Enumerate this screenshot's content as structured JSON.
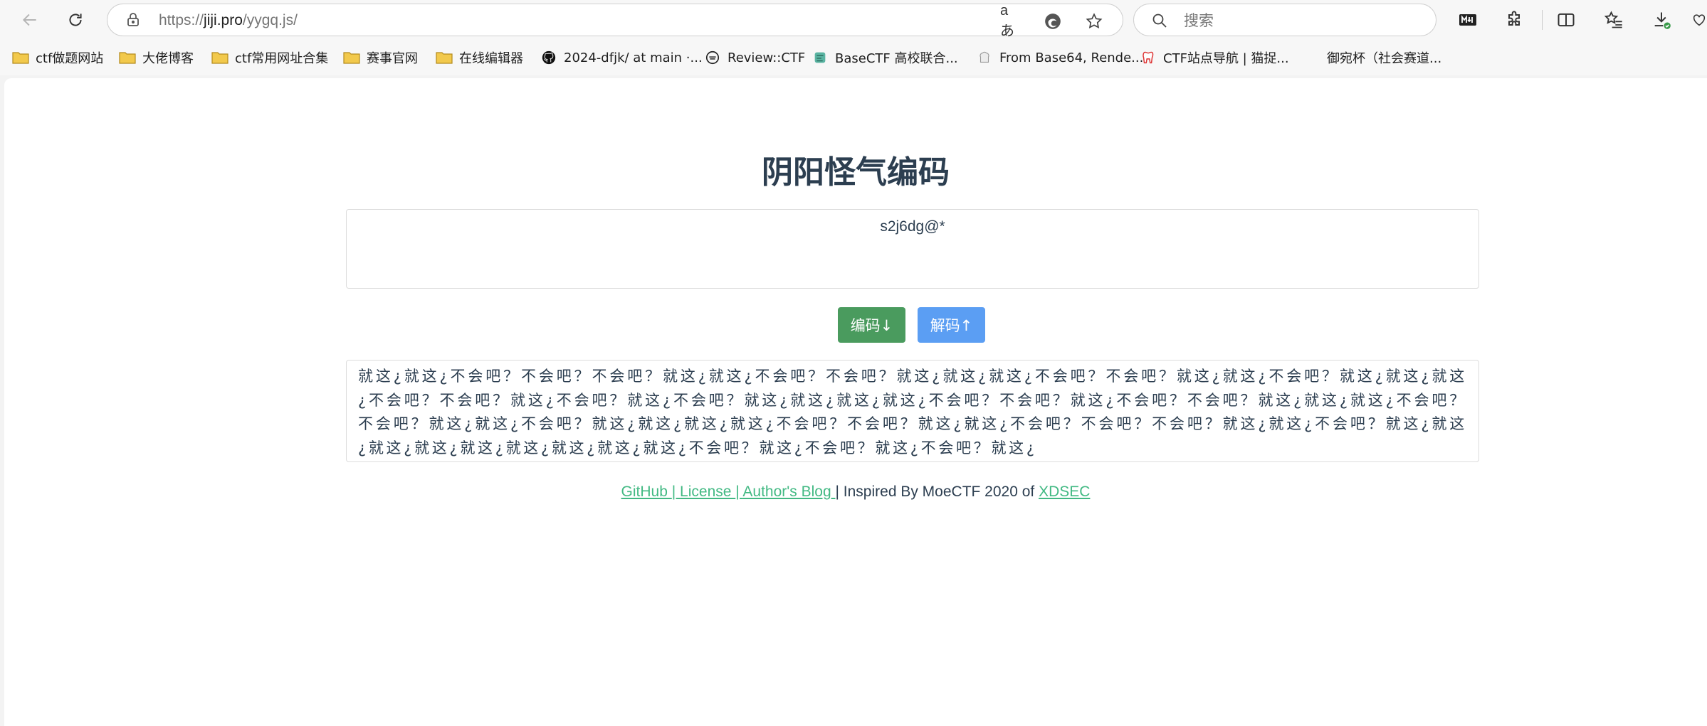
{
  "browser": {
    "url_prefix": "https://",
    "url_host": "jiji.pro",
    "url_path": "/yygq.js/",
    "read_aloud_label": "aあ",
    "search_placeholder": "搜索"
  },
  "bookmarks": [
    {
      "label": "ctf做题网站",
      "icon": "folder-icon"
    },
    {
      "label": "大佬博客",
      "icon": "folder-icon"
    },
    {
      "label": "ctf常用网址合集",
      "icon": "folder-icon"
    },
    {
      "label": "赛事官网",
      "icon": "folder-icon"
    },
    {
      "label": "在线编辑器",
      "icon": "folder-icon"
    },
    {
      "label": "2024-dfjk/ at main ·...",
      "icon": "github-icon"
    },
    {
      "label": "Review::CTF",
      "icon": "review-icon"
    },
    {
      "label": "BaseCTF 高校联合...",
      "icon": "basectf-icon"
    },
    {
      "label": "From Base64, Rende...",
      "icon": "cyberchef-icon"
    },
    {
      "label": "CTF站点导航 | 猫捉...",
      "icon": "tooth-icon"
    },
    {
      "label": "御宛杯（社会赛道...",
      "icon": "blank-icon"
    }
  ],
  "page": {
    "title": "阴阳怪气编码",
    "input_value": "s2j6dg@*",
    "encode_label": "编码↓",
    "decode_label": "解码↑",
    "output_text": "就这¿就这¿不会吧？不会吧？不会吧？就这¿就这¿不会吧？不会吧？就这¿就这¿就这¿不会吧？不会吧？就这¿就这¿不会吧？就这¿就这¿就这¿不会吧？不会吧？就这¿不会吧？就这¿不会吧？就这¿就这¿就这¿就这¿不会吧？不会吧？就这¿不会吧？不会吧？就这¿就这¿就这¿不会吧？不会吧？就这¿就这¿不会吧？就这¿就这¿就这¿就这¿不会吧？不会吧？就这¿就这¿不会吧？不会吧？不会吧？就这¿就这¿不会吧？就这¿就这¿就这¿就这¿就这¿就这¿就这¿就这¿就这¿不会吧？就这¿不会吧？就这¿不会吧？就这¿"
  },
  "footer": {
    "github": "GitHub ",
    "sep1": "| ",
    "license": "License ",
    "sep2": "| ",
    "blog": "Author's Blog ",
    "inspired": "| Inspired By MoeCTF 2020 of ",
    "xdsec": "XDSEC"
  },
  "colors": {
    "encode_button": "#4a9b5e",
    "decode_button": "#5b9ef3",
    "link": "#42b983",
    "title": "#2c3e50"
  }
}
